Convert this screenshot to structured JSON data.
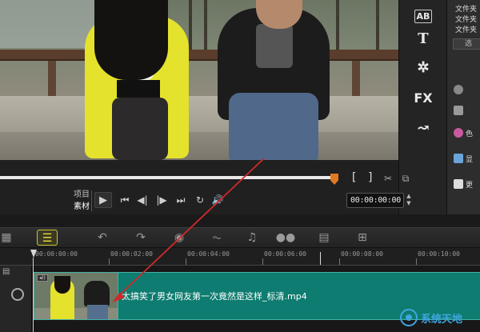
{
  "window": {
    "right_panel": {
      "menu": [
        "文件夹",
        "文件夹",
        "文件夹"
      ],
      "dropdown": "选",
      "rows": [
        {
          "label": "色",
          "color": "#c85aa0"
        },
        {
          "label": "显",
          "color": "#6aa4d8"
        },
        {
          "label": "更",
          "color": "#dddddd"
        }
      ]
    }
  },
  "side_tools": {
    "items": [
      {
        "name": "title-tool",
        "glyph": "AB"
      },
      {
        "name": "text-tool",
        "glyph": "T"
      },
      {
        "name": "effects-tool",
        "glyph": "✲"
      },
      {
        "name": "fx-tool",
        "glyph": "FX"
      },
      {
        "name": "transition-tool",
        "glyph": "↝"
      }
    ]
  },
  "player": {
    "mode_project": "项目",
    "mode_clip": "素材",
    "timecode": "00:00:00:00",
    "trim_in": "[",
    "trim_out": "]"
  },
  "timeline": {
    "ruler_labels": [
      "00:00:00:00",
      "00:00:02:00",
      "00:00:04:00",
      "00:00:06:00",
      "00:00:08:00",
      "00:00:10:00"
    ],
    "clip_name": "太搞笑了男女网友第一次竟然是这样_标清.mp4",
    "clip_color": "#0e7c70"
  },
  "watermark": {
    "text": "系统天地"
  },
  "colors": {
    "accent": "#e07a22",
    "active_tool": "#f0e040",
    "annotation": "#d02a2a"
  }
}
